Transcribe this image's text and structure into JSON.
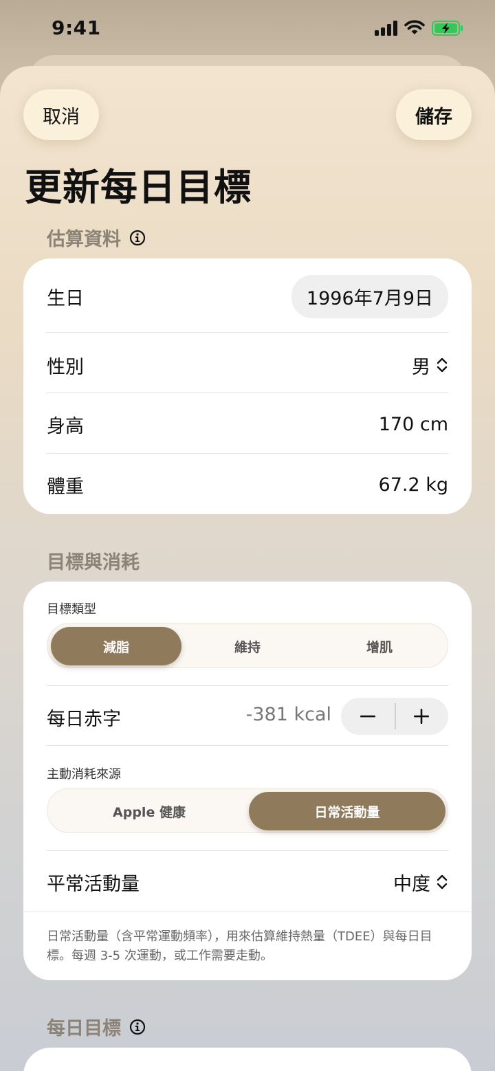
{
  "status_bar": {
    "time": "9:41"
  },
  "header": {
    "cancel_label": "取消",
    "save_label": "儲存",
    "title": "更新每日目標"
  },
  "estimate_section": {
    "title": "估算資料",
    "rows": {
      "birthday": {
        "label": "生日",
        "value": "1996年7月9日"
      },
      "sex": {
        "label": "性別",
        "value": "男"
      },
      "height": {
        "label": "身高",
        "value": "170 cm"
      },
      "weight": {
        "label": "體重",
        "value": "67.2 kg"
      }
    }
  },
  "goal_section": {
    "title": "目標與消耗",
    "goal_type": {
      "label": "目標類型",
      "options": [
        "減脂",
        "維持",
        "增肌"
      ],
      "selected": "減脂"
    },
    "daily_deficit": {
      "label": "每日赤字",
      "value": "-381 kcal"
    },
    "active_source": {
      "label": "主動消耗來源",
      "options": [
        "Apple 健康",
        "日常活動量"
      ],
      "selected": "日常活動量"
    },
    "activity_level": {
      "label": "平常活動量",
      "value": "中度"
    },
    "note": "日常活動量（含平常運動頻率），用來估算維持熱量（TDEE）與每日目標。每週 3-5 次運動，或工作需要走動。"
  },
  "daily_goal_section": {
    "title": "每日目標"
  },
  "colors": {
    "accent": "#8f7a5c",
    "button_bg": "#fbf0d9",
    "battery_green": "#34c759"
  }
}
